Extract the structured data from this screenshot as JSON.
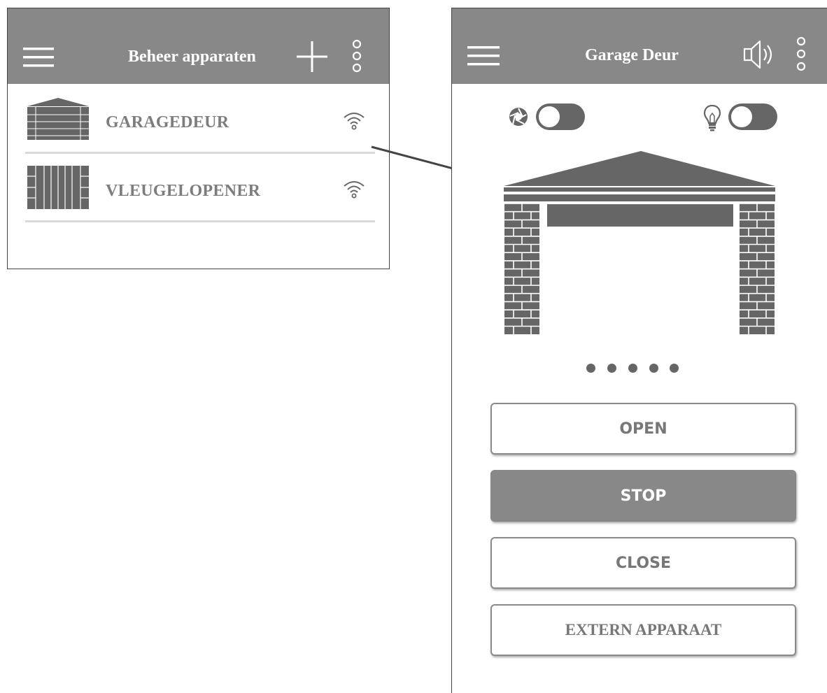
{
  "devices_screen": {
    "title": "Beheer apparaten",
    "devices": [
      {
        "label": "GARAGEDEUR",
        "icon": "garage-door-icon",
        "status_icon": "wifi-icon"
      },
      {
        "label": "VLEUGELOPENER",
        "icon": "swing-gate-icon",
        "status_icon": "wifi-icon"
      }
    ]
  },
  "detail_screen": {
    "title": "Garage Deur",
    "toggles": [
      {
        "icon": "shutter-icon",
        "state": "off"
      },
      {
        "icon": "lightbulb-icon",
        "state": "off"
      }
    ],
    "pager_dots": 5,
    "buttons": {
      "open": "OPEN",
      "stop": "STOP",
      "close": "CLOSE",
      "extern": "EXTERN APPARAAT"
    }
  },
  "colors": {
    "appbar": "#888888",
    "icon_dark": "#666666",
    "divider": "#d9d9d9"
  }
}
